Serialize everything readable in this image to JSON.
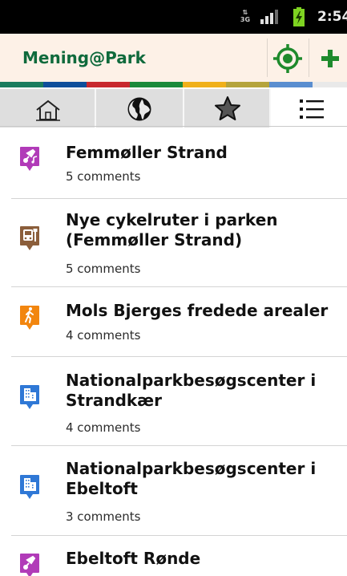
{
  "status_bar": {
    "network_type": "3G",
    "time": "2:54"
  },
  "action_bar": {
    "title": "Mening@Park",
    "locate_icon": "crosshair-location-icon",
    "add_icon": "plus-icon"
  },
  "colors": {
    "brand": "#0f6a3c",
    "action_bar_bg": "#fdf1e7",
    "stripe": [
      "#1a7d5e",
      "#0f4f9b",
      "#c8282e",
      "#1a8a3a",
      "#f0b01a",
      "#b5a43c",
      "#5a8ed0",
      "#e9e9e9"
    ]
  },
  "tabs": [
    {
      "icon": "home-icon",
      "active": false
    },
    {
      "icon": "map-globe-icon",
      "active": false
    },
    {
      "icon": "star-icon",
      "active": false
    },
    {
      "icon": "list-icon",
      "active": true
    }
  ],
  "places": [
    {
      "title": "Femmøller Strand",
      "comments": "5 comments",
      "icon": "music-guitar-icon",
      "pin_color": "#b13bb8"
    },
    {
      "title": "Nye cykelruter i parken\n(Femmøller Strand)",
      "comments": "5 comments",
      "icon": "bus-stop-icon",
      "pin_color": "#8b5e3b"
    },
    {
      "title": "Mols Bjerges fredede arealer",
      "comments": "4 comments",
      "icon": "hiking-person-icon",
      "pin_color": "#f2860f"
    },
    {
      "title": "Nationalparkbesøgscenter i\nStrandkær",
      "comments": "4 comments",
      "icon": "building-icon",
      "pin_color": "#2f78d6"
    },
    {
      "title": "Nationalparkbesøgscenter i\nEbeltoft",
      "comments": "3 comments",
      "icon": "building-icon",
      "pin_color": "#2f78d6"
    },
    {
      "title": "Ebeltoft Rønde",
      "comments": "",
      "icon": "music-guitar-icon",
      "pin_color": "#b13bb8"
    }
  ]
}
